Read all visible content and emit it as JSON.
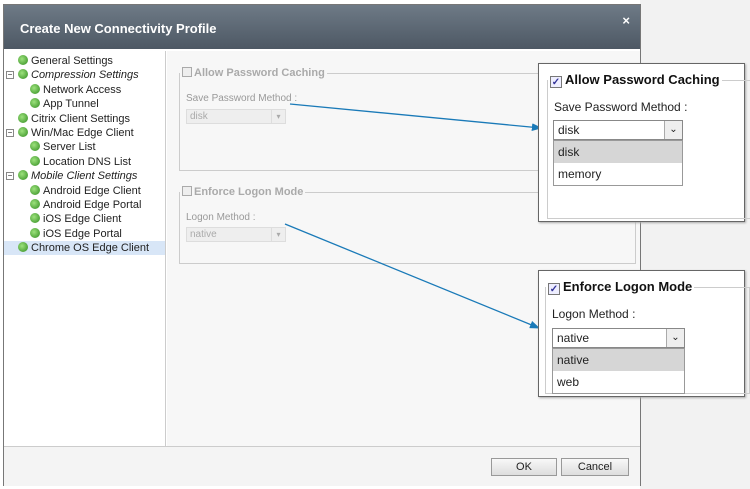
{
  "dialog": {
    "title": "Create New Connectivity Profile",
    "close": "×"
  },
  "tree": [
    {
      "label": "General Settings",
      "level": 0
    },
    {
      "label": "Compression Settings",
      "level": 0,
      "expandable": true,
      "italic": true
    },
    {
      "label": "Network Access",
      "level": 1
    },
    {
      "label": "App Tunnel",
      "level": 1
    },
    {
      "label": "Citrix Client Settings",
      "level": 0
    },
    {
      "label": "Win/Mac Edge Client",
      "level": 0,
      "expandable": true
    },
    {
      "label": "Server List",
      "level": 1
    },
    {
      "label": "Location DNS List",
      "level": 1
    },
    {
      "label": "Mobile Client Settings",
      "level": 0,
      "expandable": true,
      "italic": true
    },
    {
      "label": "Android Edge Client",
      "level": 1
    },
    {
      "label": "Android Edge Portal",
      "level": 1
    },
    {
      "label": "iOS Edge Client",
      "level": 1
    },
    {
      "label": "iOS Edge Portal",
      "level": 1
    },
    {
      "label": "Chrome OS Edge Client",
      "level": 0,
      "selected": true
    }
  ],
  "form": {
    "pw_legend": "Allow Password Caching",
    "pw_label": "Save Password Method :",
    "pw_value": "disk",
    "logon_legend": "Enforce Logon Mode",
    "logon_label": "Logon Method :",
    "logon_value": "native"
  },
  "footer": {
    "ok": "OK",
    "cancel": "Cancel"
  },
  "callout_pw": {
    "legend": "Allow Password Caching",
    "label": "Save Password Method :",
    "value": "disk",
    "options": [
      "disk",
      "memory"
    ]
  },
  "callout_logon": {
    "legend": "Enforce Logon Mode",
    "label": "Logon Method :",
    "value": "native",
    "options": [
      "native",
      "web"
    ]
  },
  "colors": {
    "arrow": "#1a7ab8",
    "title_bg": "#5a6672",
    "selected": "#d8e6f7"
  }
}
